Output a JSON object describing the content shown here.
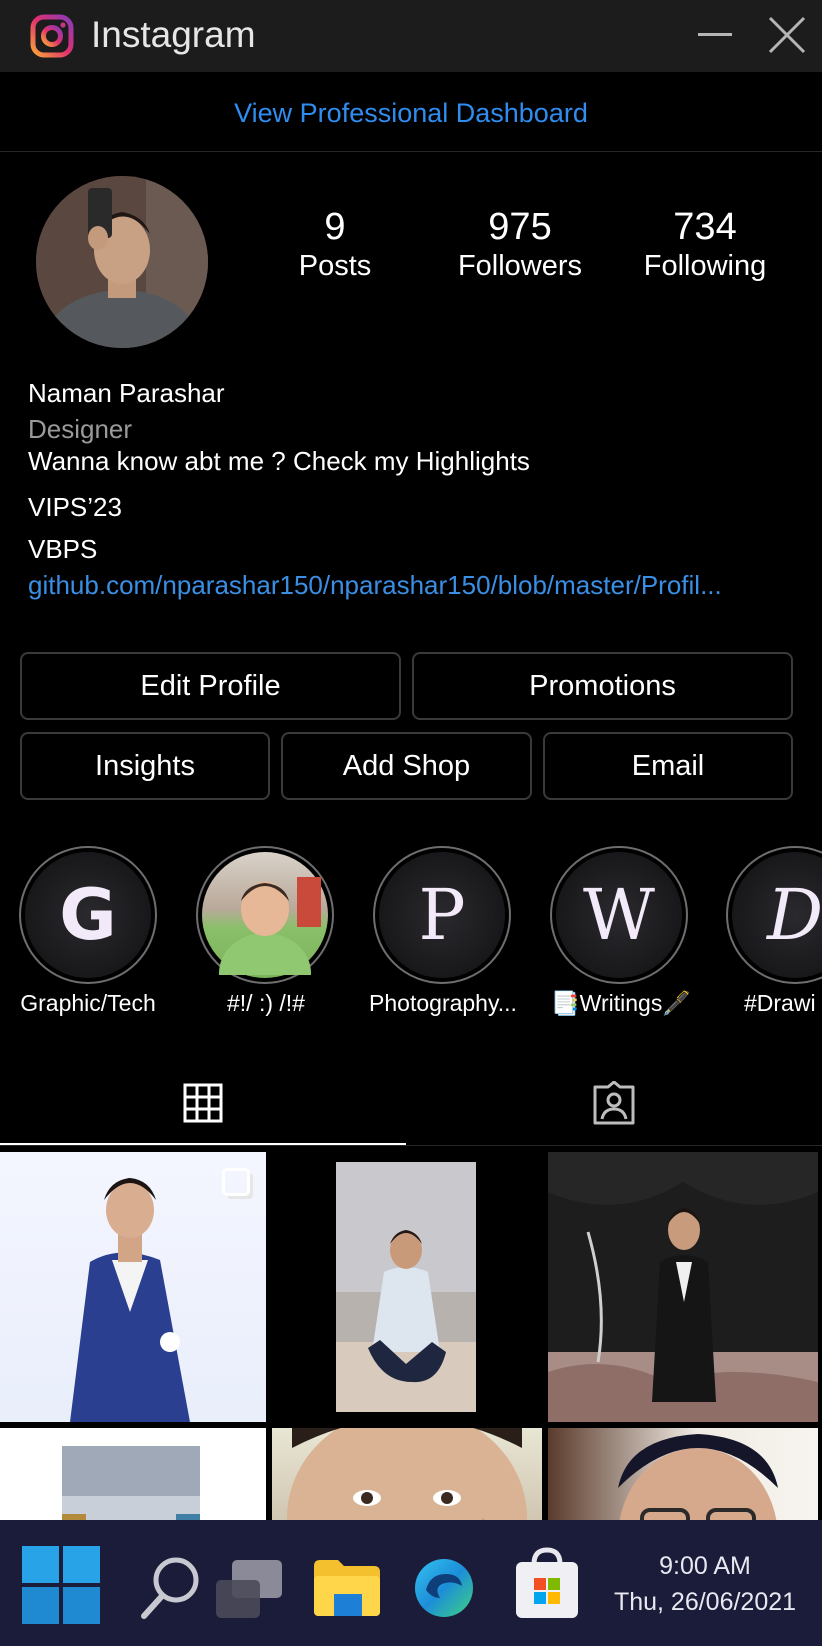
{
  "window": {
    "title": "Instagram",
    "icons": {
      "app": "instagram-icon",
      "minimize": "minimize-icon",
      "close": "close-icon"
    }
  },
  "dashboard": {
    "label": "View Professional Dashboard",
    "color": "#2f8df0"
  },
  "profile": {
    "stats": [
      {
        "value": "9",
        "label": "Posts"
      },
      {
        "value": "975",
        "label": "Followers"
      },
      {
        "value": "734",
        "label": "Following"
      }
    ],
    "name": "Naman Parashar",
    "category": "Designer",
    "bio_lines": [
      "Wanna know abt me ? Check my Highlights",
      "VIPS’23",
      "VBPS"
    ],
    "link": "github.com/nparashar150/nparashar150/blob/master/Profil..."
  },
  "buttons": {
    "edit_profile": "Edit Profile",
    "promotions": "Promotions",
    "insights": "Insights",
    "add_shop": "Add Shop",
    "email": "Email"
  },
  "highlights": [
    {
      "letter": "G",
      "label": "Graphic/Tech"
    },
    {
      "letter": "",
      "label": "#!/ :) /!#"
    },
    {
      "letter": "P",
      "label": "Photography..."
    },
    {
      "letter": "W",
      "label": "📑Writings🖋️"
    },
    {
      "letter": "D",
      "label": "#Drawi"
    }
  ],
  "tabs": {
    "grid": "grid-icon",
    "tagged": "tagged-person-icon"
  },
  "taskbar": {
    "icons": [
      "windows-start-icon",
      "search-icon",
      "task-view-icon",
      "file-explorer-icon",
      "edge-browser-icon",
      "store-icon"
    ],
    "time": "9:00 AM",
    "date": "Thu, 26/06/2021"
  }
}
